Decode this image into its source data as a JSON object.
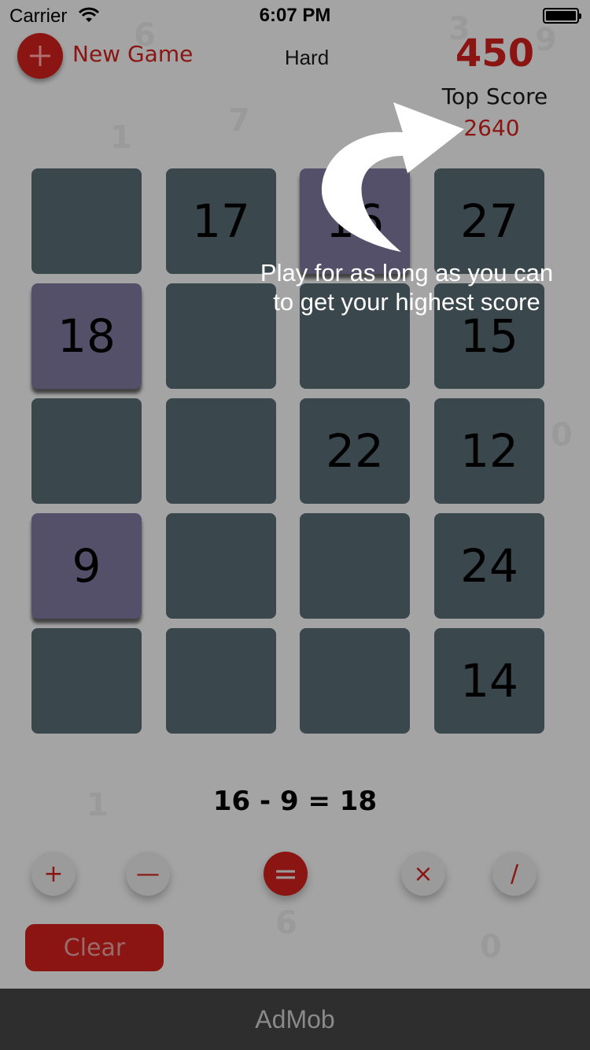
{
  "status_bar": {
    "carrier": "Carrier",
    "time": "6:07 PM"
  },
  "header": {
    "new_game_label": "New Game",
    "difficulty": "Hard",
    "score": "450",
    "top_score_label": "Top Score",
    "top_score_value": "2640"
  },
  "grid": {
    "rows": [
      [
        "",
        "17",
        "16",
        "27"
      ],
      [
        "18",
        "",
        "",
        "15"
      ],
      [
        "",
        "",
        "22",
        "12"
      ],
      [
        "9",
        "",
        "",
        "24"
      ],
      [
        "",
        "",
        "",
        "14"
      ]
    ],
    "selected_tiles": [
      "16",
      "18",
      "9"
    ]
  },
  "equation": "16 - 9 = 18",
  "operators": {
    "plus": "+",
    "minus": "—",
    "equals": "=",
    "times": "×",
    "divide": "/"
  },
  "clear_label": "Clear",
  "ad_label": "AdMob",
  "tutorial": {
    "line1": "Play for as long as you can",
    "line2": "to get your highest score"
  },
  "colors": {
    "accent": "#8a1512",
    "tile": "#3a474d",
    "tile_selected": "#555069",
    "background": "#a4a4a4"
  }
}
